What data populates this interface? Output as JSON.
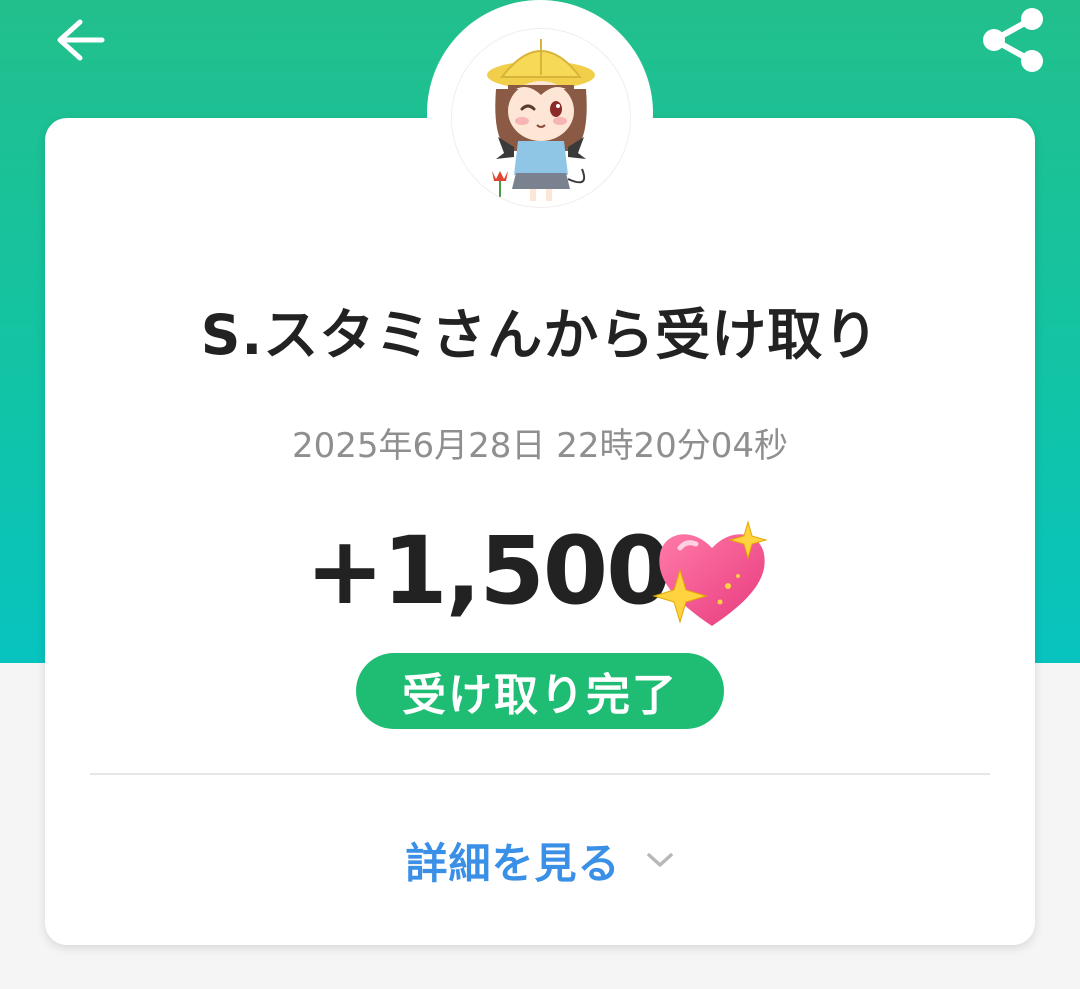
{
  "header": {
    "back_icon": "arrow-left-icon",
    "share_icon": "share-icon"
  },
  "card": {
    "avatar_icon": "user-avatar-illustration",
    "title": "S.スタミさんから受け取り",
    "timestamp": "2025年6月28日 22時20分04秒",
    "amount": "+1,500",
    "amount_icon": "sparkling-heart-icon",
    "status_badge": "受け取り完了",
    "details_link": "詳細を見る",
    "details_icon": "chevron-down-icon"
  },
  "colors": {
    "header_green": "#22bf8c",
    "header_teal": "#08c4c0",
    "badge_green": "#1fbd73",
    "link_blue": "#3a8fe6",
    "heart_pink": "#f0508f"
  }
}
